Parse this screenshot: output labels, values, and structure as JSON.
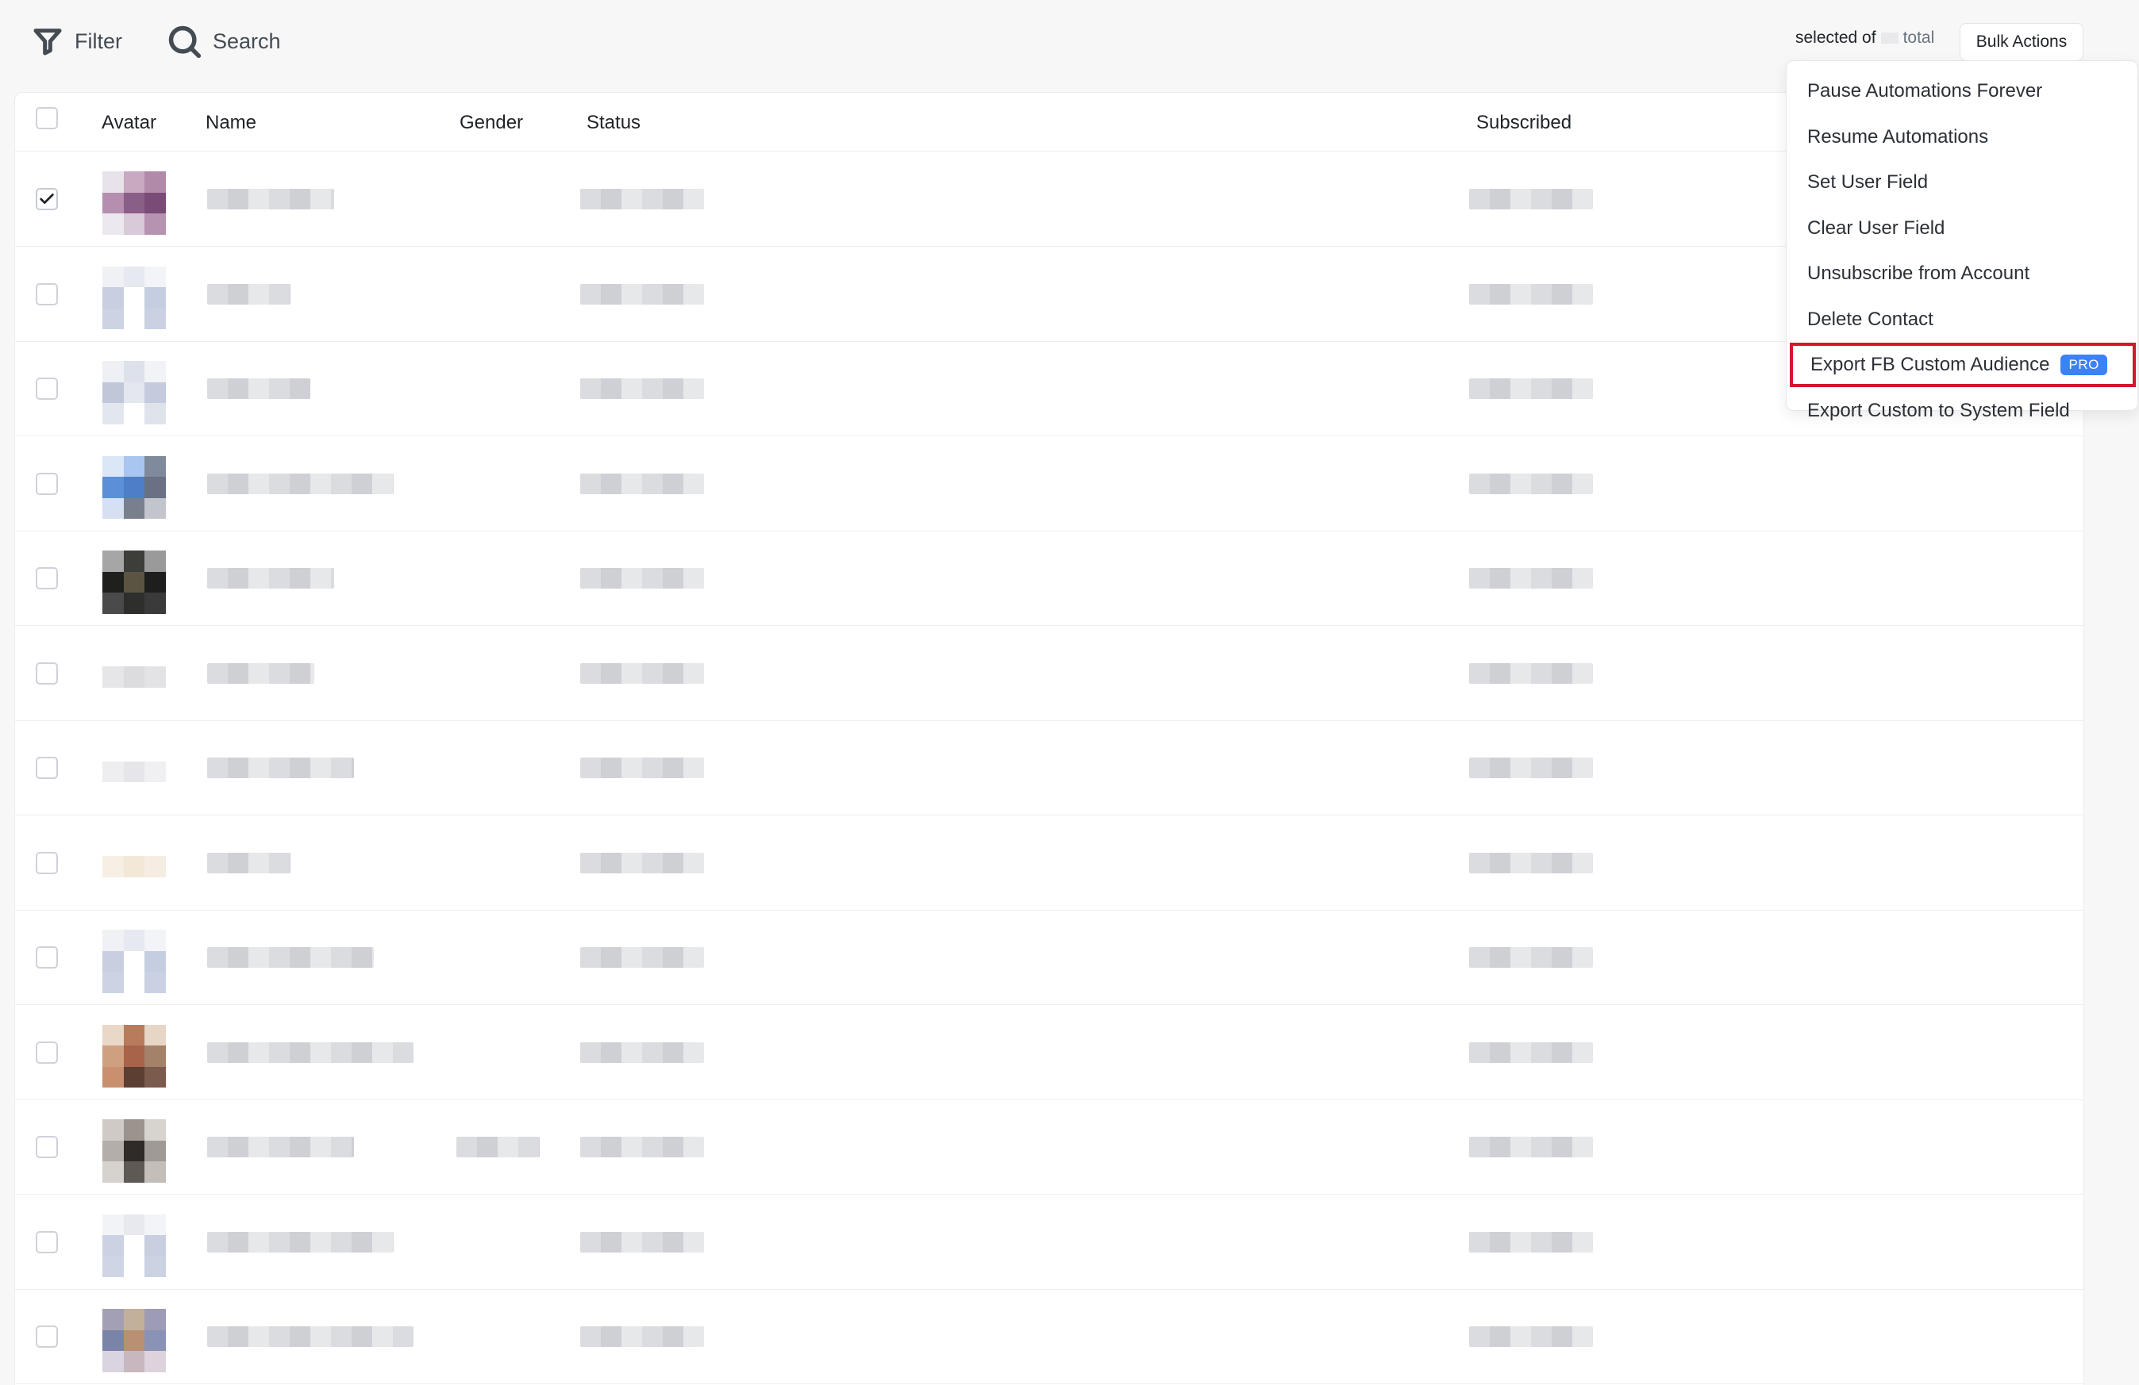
{
  "toolbar": {
    "filter_label": "Filter",
    "search_label": "Search",
    "selection_word": "selected of",
    "total_word": "total",
    "bulk_actions_label": "Bulk Actions"
  },
  "table": {
    "columns": {
      "avatar": "Avatar",
      "name": "Name",
      "gender": "Gender",
      "status": "Status",
      "subscribed": "Subscribed"
    },
    "rows": [
      {
        "checked": true,
        "avatar": [
          "#e8e3ea",
          "#c9a9c2",
          "#b08aa8",
          "#b68fb0",
          "#8a5f87",
          "#7b4b78",
          "#ece8ef",
          "#d8cad8",
          "#b593b1"
        ]
      },
      {
        "checked": false,
        "avatar": [
          "#f0f1f5",
          "#e7e9f0",
          "#f3f4f7",
          "#c7cfe0",
          "#ffffff",
          "#c5cde0",
          "#ccd3e3",
          "#ffffff",
          "#c9d1e2"
        ]
      },
      {
        "checked": false,
        "avatar": [
          "#eef0f5",
          "#dde1ea",
          "#f2f3f6",
          "#bfc7d8",
          "#e4e7ee",
          "#c3cbdc",
          "#e2e6ee",
          "#ffffff",
          "#dfe3eb"
        ]
      },
      {
        "checked": false,
        "avatar": [
          "#dbe6f7",
          "#a8c6ef",
          "#7f8a9c",
          "#5b8fd8",
          "#4e7ec8",
          "#6a7185",
          "#d5e0f2",
          "#7a7f8d",
          "#c3c5cc"
        ]
      },
      {
        "checked": false,
        "avatar": [
          "#a6a6a6",
          "#3d3d3a",
          "#9a9a9a",
          "#1f1f1e",
          "#5b5442",
          "#1e1e1e",
          "#4a4a4a",
          "#2e2e2d",
          "#3a3a3a"
        ]
      },
      {
        "checked": false,
        "avatar": [
          "#ffffff",
          "#ffffff",
          "#ffffff",
          "#e6e6e9",
          "#dcdcdf",
          "#e3e3e6",
          "#ffffff",
          "#ffffff",
          "#ffffff"
        ]
      },
      {
        "checked": false,
        "avatar": [
          "#ffffff",
          "#ffffff",
          "#ffffff",
          "#eeeef1",
          "#e6e6ea",
          "#f0f0f3",
          "#ffffff",
          "#ffffff",
          "#ffffff"
        ]
      },
      {
        "checked": false,
        "avatar": [
          "#ffffff",
          "#ffffff",
          "#ffffff",
          "#f7efe4",
          "#f3e7d8",
          "#f5ede3",
          "#ffffff",
          "#ffffff",
          "#ffffff"
        ]
      },
      {
        "checked": false,
        "avatar": [
          "#f0f1f5",
          "#e7e9f0",
          "#f3f4f7",
          "#c7cfe0",
          "#ffffff",
          "#c5cde0",
          "#ccd3e3",
          "#ffffff",
          "#c9d1e2"
        ]
      },
      {
        "checked": false,
        "avatar": [
          "#e9d7c7",
          "#b87c5c",
          "#e7d5c5",
          "#cfa080",
          "#a8634b",
          "#a4826a",
          "#c99070",
          "#5c3e33",
          "#7a5b4d"
        ]
      },
      {
        "checked": false,
        "avatar": [
          "#cfcac6",
          "#9a938e",
          "#d7d3cf",
          "#b3aea9",
          "#2e2b29",
          "#a09a95",
          "#d6d2ce",
          "#5f5955",
          "#c3beba"
        ]
      },
      {
        "checked": false,
        "avatar": [
          "#f2f3f6",
          "#e7e9ef",
          "#f3f4f7",
          "#cbd2e2",
          "#ffffff",
          "#c8cfe0",
          "#cfd5e4",
          "#ffffff",
          "#cbd2e2"
        ]
      },
      {
        "checked": false,
        "avatar": [
          "#a39fb4",
          "#c2b09b",
          "#9d9bb5",
          "#7a83a8",
          "#b89073",
          "#8a93b5",
          "#d9d4e0",
          "#c8b7bf",
          "#dcd3dc"
        ]
      }
    ]
  },
  "bulk_menu": {
    "items": [
      {
        "label": "Pause Automations Forever",
        "pro": false
      },
      {
        "label": "Resume Automations",
        "pro": false
      },
      {
        "label": "Set User Field",
        "pro": false
      },
      {
        "label": "Clear User Field",
        "pro": false
      },
      {
        "label": "Unsubscribe from Account",
        "pro": false
      },
      {
        "label": "Delete Contact",
        "pro": false
      },
      {
        "label": "Export FB Custom Audience",
        "pro": true,
        "highlighted": true
      },
      {
        "label": "Export Custom to System Field",
        "pro": false
      }
    ],
    "pro_badge_label": "PRO"
  },
  "colors": {
    "highlight_outline": "#d9142b",
    "pro_badge": "#3b82f6"
  }
}
